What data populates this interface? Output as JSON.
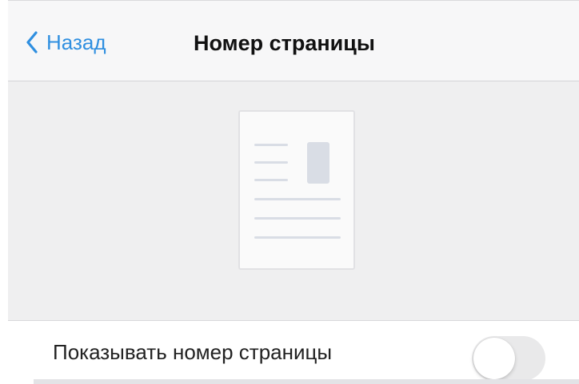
{
  "navbar": {
    "back_label": "Назад",
    "title": "Номер страницы"
  },
  "preview": {
    "icon": "page-layout-icon"
  },
  "settings": {
    "show_page_number_label": "Показывать номер страницы",
    "show_page_number_on": false
  },
  "colors": {
    "accent": "#2f8fe0",
    "navbar_bg": "#f7f7f8",
    "preview_bg": "#efeff0",
    "toggle_off": "#e9e9ea"
  }
}
